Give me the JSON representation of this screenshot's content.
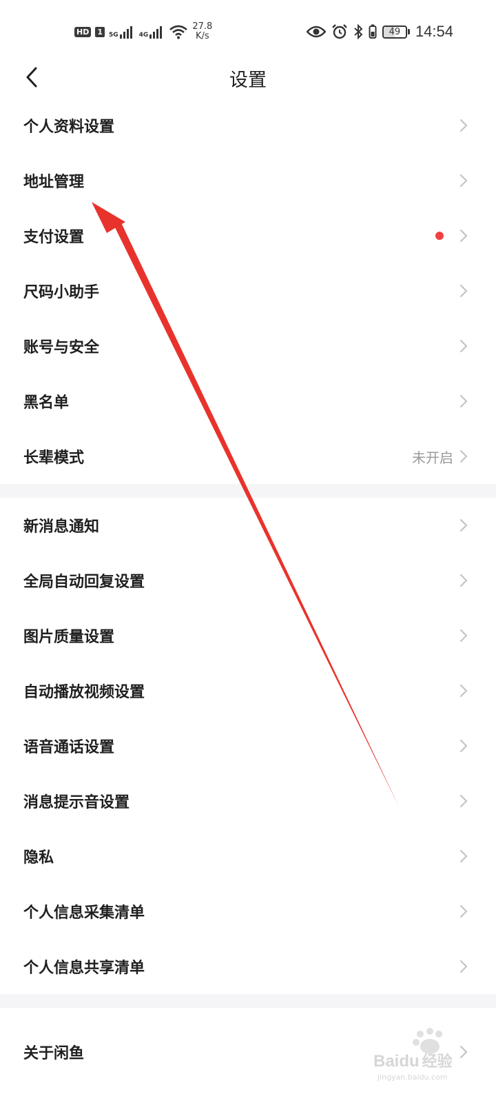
{
  "status_bar": {
    "hd": "HD",
    "sim": "1",
    "network_1": "5G",
    "network_2": "4G",
    "speed_value": "27.8",
    "speed_unit": "K/s",
    "battery_level": "49",
    "time": "14:54"
  },
  "nav": {
    "title": "设置"
  },
  "groups": [
    {
      "items": [
        {
          "label": "个人资料设置"
        },
        {
          "label": "地址管理"
        },
        {
          "label": "支付设置",
          "badge": "red-dot"
        },
        {
          "label": "尺码小助手"
        },
        {
          "label": "账号与安全"
        },
        {
          "label": "黑名单"
        },
        {
          "label": "长辈模式",
          "value": "未开启"
        }
      ]
    },
    {
      "items": [
        {
          "label": "新消息通知"
        },
        {
          "label": "全局自动回复设置"
        },
        {
          "label": "图片质量设置"
        },
        {
          "label": "自动播放视频设置"
        },
        {
          "label": "语音通话设置"
        },
        {
          "label": "消息提示音设置"
        },
        {
          "label": "隐私"
        },
        {
          "label": "个人信息采集清单"
        },
        {
          "label": "个人信息共享清单"
        }
      ]
    },
    {
      "items": [
        {
          "label": "关于闲鱼"
        }
      ]
    }
  ],
  "icons": {
    "back": "chevron-left-icon",
    "row_arrow": "chevron-right-icon",
    "eye": "eye-icon",
    "alarm": "alarm-icon",
    "bluetooth": "bluetooth-icon",
    "wifi": "wifi-icon",
    "signal": "signal-icon"
  },
  "colors": {
    "annotation_arrow": "#e8332c",
    "badge_dot": "#f04142",
    "divider": "#f5f5f7",
    "secondary_text": "#9a9a9a"
  },
  "watermark": {
    "brand": "Baidu",
    "cn": "经验",
    "url": "jingyan.baidu.com"
  }
}
